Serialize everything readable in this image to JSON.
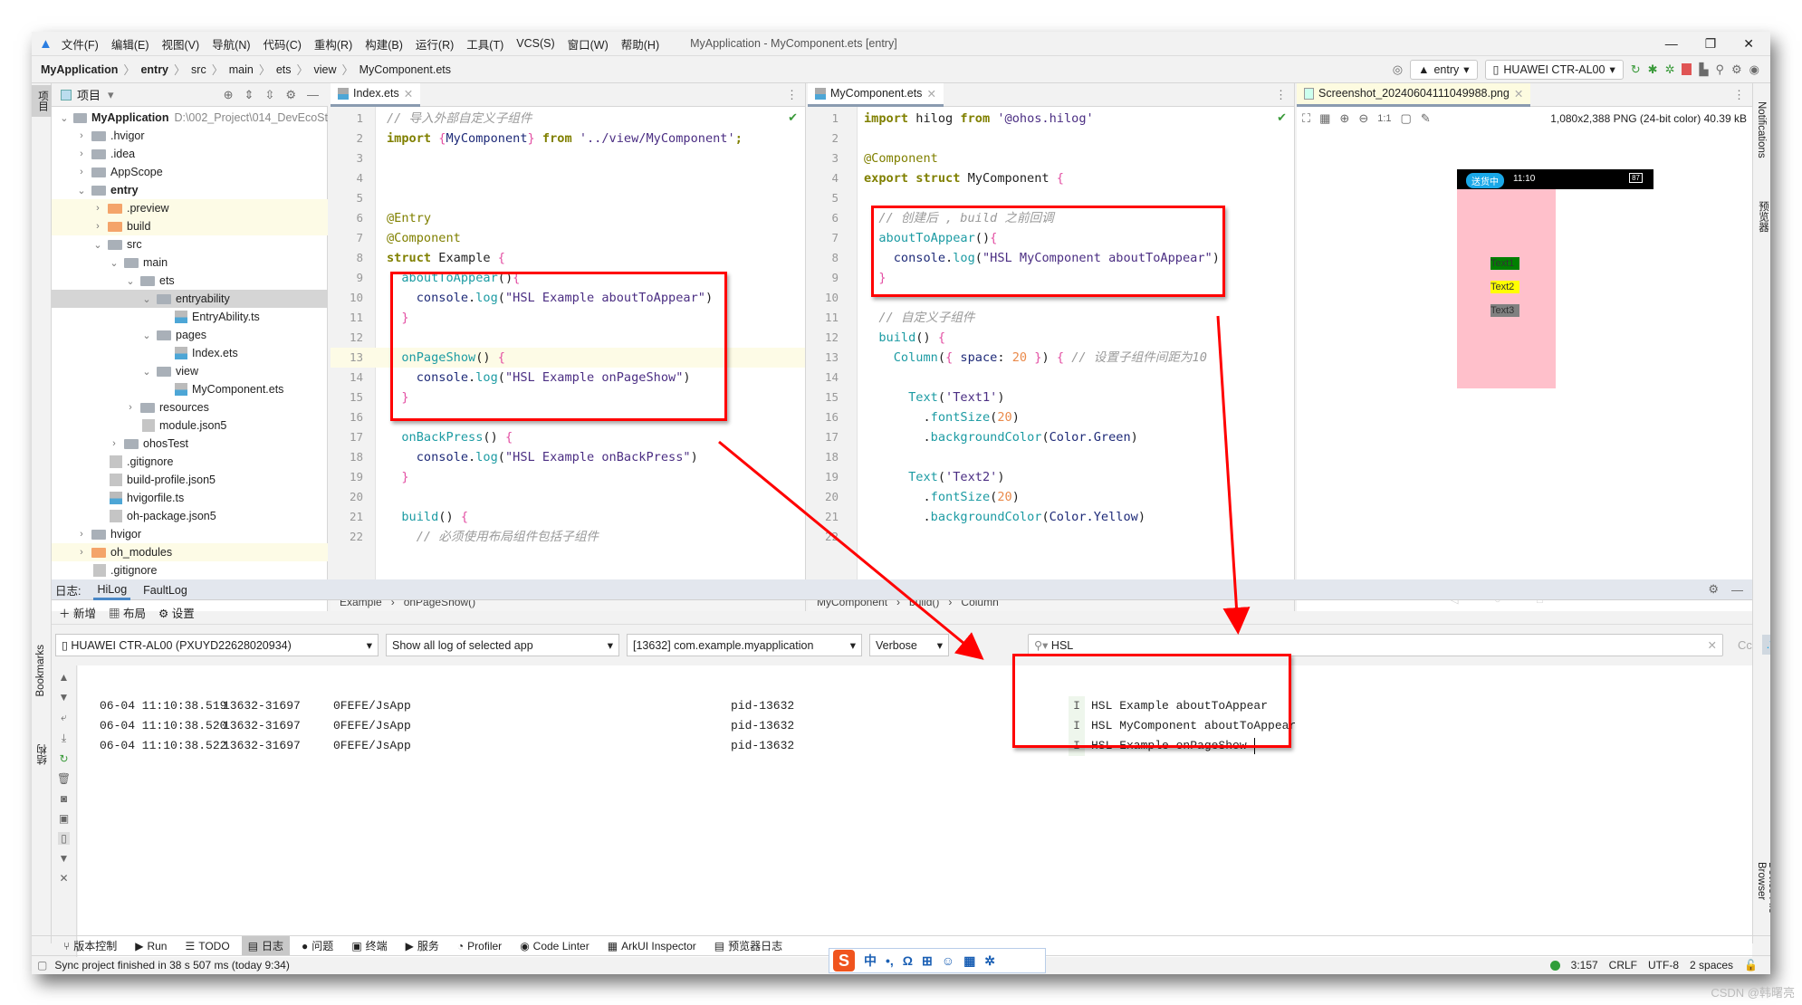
{
  "titlebar": {
    "menus": [
      "文件(F)",
      "编辑(E)",
      "视图(V)",
      "导航(N)",
      "代码(C)",
      "重构(R)",
      "构建(B)",
      "运行(R)",
      "工具(T)",
      "VCS(S)",
      "窗口(W)",
      "帮助(H)"
    ],
    "title": "MyApplication - MyComponent.ets [entry]"
  },
  "navbar": {
    "breadcrumb": [
      "MyApplication",
      "entry",
      "src",
      "main",
      "ets",
      "view",
      "MyComponent.ets"
    ],
    "run_config": "entry",
    "device": "HUAWEI CTR-AL00"
  },
  "project": {
    "header": "项目",
    "side_label": "项目",
    "tree": [
      {
        "d": 0,
        "t": "MyApplication",
        "k": "mod",
        "open": true,
        "extra": "D:\\002_Project\\014_DevEcoSt"
      },
      {
        "d": 1,
        "t": ".hvigor",
        "k": "dir"
      },
      {
        "d": 1,
        "t": ".idea",
        "k": "dir"
      },
      {
        "d": 1,
        "t": "AppScope",
        "k": "dir"
      },
      {
        "d": 1,
        "t": "entry",
        "k": "mod",
        "open": true
      },
      {
        "d": 2,
        "t": ".preview",
        "k": "odir",
        "hl": true
      },
      {
        "d": 2,
        "t": "build",
        "k": "odir",
        "hl": true
      },
      {
        "d": 2,
        "t": "src",
        "k": "dir",
        "open": true
      },
      {
        "d": 3,
        "t": "main",
        "k": "dir",
        "open": true
      },
      {
        "d": 4,
        "t": "ets",
        "k": "dir",
        "open": true
      },
      {
        "d": 5,
        "t": "entryability",
        "k": "dir",
        "open": true,
        "sel": true
      },
      {
        "d": 6,
        "t": "EntryAbility.ts",
        "k": "file"
      },
      {
        "d": 5,
        "t": "pages",
        "k": "dir",
        "open": true
      },
      {
        "d": 6,
        "t": "Index.ets",
        "k": "file"
      },
      {
        "d": 5,
        "t": "view",
        "k": "dir",
        "open": true
      },
      {
        "d": 6,
        "t": "MyComponent.ets",
        "k": "file"
      },
      {
        "d": 4,
        "t": "resources",
        "k": "dir"
      },
      {
        "d": 4,
        "t": "module.json5",
        "k": "json"
      },
      {
        "d": 3,
        "t": "ohosTest",
        "k": "dir"
      },
      {
        "d": 2,
        "t": ".gitignore",
        "k": "json"
      },
      {
        "d": 2,
        "t": "build-profile.json5",
        "k": "json"
      },
      {
        "d": 2,
        "t": "hvigorfile.ts",
        "k": "file"
      },
      {
        "d": 2,
        "t": "oh-package.json5",
        "k": "json"
      },
      {
        "d": 1,
        "t": "hvigor",
        "k": "dir"
      },
      {
        "d": 1,
        "t": "oh_modules",
        "k": "odir",
        "hl": true
      },
      {
        "d": 1,
        "t": ".gitignore",
        "k": "json"
      }
    ]
  },
  "editor_index": {
    "tab": "Index.ets",
    "breadcrumb": [
      "Example",
      "onPageShow()"
    ],
    "lines": [
      [
        [
          "cm",
          "// 导入外部自定义子组件"
        ]
      ],
      [
        [
          "kw",
          "import "
        ],
        [
          "br",
          "{"
        ],
        [
          "ob",
          "MyComponent"
        ],
        [
          "br",
          "}"
        ],
        [
          "kw",
          " from "
        ],
        [
          "st",
          "'../view/MyComponent'"
        ],
        [
          "kw",
          ";"
        ]
      ],
      [],
      [],
      [],
      [
        [
          "an",
          "@Entry"
        ]
      ],
      [
        [
          "an",
          "@Component"
        ]
      ],
      [
        [
          "kw",
          "struct "
        ],
        [
          "pl",
          "Example "
        ],
        [
          "br",
          "{"
        ]
      ],
      [
        [
          "pl",
          "  "
        ],
        [
          "fn",
          "aboutToAppear"
        ],
        [
          "pl",
          "()"
        ],
        [
          "br",
          "{"
        ]
      ],
      [
        [
          "pl",
          "    "
        ],
        [
          "ob",
          "console"
        ],
        [
          "pl",
          "."
        ],
        [
          "fn",
          "log"
        ],
        [
          "pl",
          "("
        ],
        [
          "st",
          "\"HSL Example aboutToAppear\""
        ],
        [
          "pl",
          ")"
        ]
      ],
      [
        [
          "pl",
          "  "
        ],
        [
          "br",
          "}"
        ]
      ],
      [],
      [
        [
          "pl",
          "  "
        ],
        [
          "fn",
          "onPageShow"
        ],
        [
          "pl",
          "() "
        ],
        [
          "br",
          "{"
        ]
      ],
      [
        [
          "pl",
          "    "
        ],
        [
          "ob",
          "console"
        ],
        [
          "pl",
          "."
        ],
        [
          "fn",
          "log"
        ],
        [
          "pl",
          "("
        ],
        [
          "st",
          "\"HSL Example onPageShow\""
        ],
        [
          "pl",
          ")"
        ]
      ],
      [
        [
          "pl",
          "  "
        ],
        [
          "br",
          "}"
        ]
      ],
      [],
      [
        [
          "pl",
          "  "
        ],
        [
          "fn",
          "onBackPress"
        ],
        [
          "pl",
          "() "
        ],
        [
          "br",
          "{"
        ]
      ],
      [
        [
          "pl",
          "    "
        ],
        [
          "ob",
          "console"
        ],
        [
          "pl",
          "."
        ],
        [
          "fn",
          "log"
        ],
        [
          "pl",
          "("
        ],
        [
          "st",
          "\"HSL Example onBackPress\""
        ],
        [
          "pl",
          ")"
        ]
      ],
      [
        [
          "pl",
          "  "
        ],
        [
          "br",
          "}"
        ]
      ],
      [],
      [
        [
          "pl",
          "  "
        ],
        [
          "fn",
          "build"
        ],
        [
          "pl",
          "() "
        ],
        [
          "br",
          "{"
        ]
      ],
      [
        [
          "pl",
          "    "
        ],
        [
          "cm",
          "// 必须使用布局组件包括子组件"
        ]
      ]
    ]
  },
  "editor_component": {
    "tab": "MyComponent.ets",
    "breadcrumb": [
      "MyComponent",
      "build()",
      "Column"
    ],
    "lines": [
      [
        [
          "kw",
          "import "
        ],
        [
          "pl",
          "hilog "
        ],
        [
          "kw",
          "from "
        ],
        [
          "st",
          "'@ohos.hilog'"
        ]
      ],
      [],
      [
        [
          "an",
          "@Component"
        ]
      ],
      [
        [
          "kw",
          "export struct "
        ],
        [
          "pl",
          "MyComponent "
        ],
        [
          "br",
          "{"
        ]
      ],
      [],
      [
        [
          "pl",
          "  "
        ],
        [
          "cm",
          "// 创建后 , build 之前回调"
        ]
      ],
      [
        [
          "pl",
          "  "
        ],
        [
          "fn",
          "aboutToAppear"
        ],
        [
          "pl",
          "()"
        ],
        [
          "br",
          "{"
        ]
      ],
      [
        [
          "pl",
          "    "
        ],
        [
          "ob",
          "console"
        ],
        [
          "pl",
          "."
        ],
        [
          "fn",
          "log"
        ],
        [
          "pl",
          "("
        ],
        [
          "st",
          "\"HSL MyComponent aboutToAppear\""
        ],
        [
          "pl",
          ")"
        ]
      ],
      [
        [
          "pl",
          "  "
        ],
        [
          "br",
          "}"
        ]
      ],
      [],
      [
        [
          "pl",
          "  "
        ],
        [
          "cm",
          "// 自定义子组件"
        ]
      ],
      [
        [
          "pl",
          "  "
        ],
        [
          "fn",
          "build"
        ],
        [
          "pl",
          "() "
        ],
        [
          "br",
          "{"
        ]
      ],
      [
        [
          "pl",
          "    "
        ],
        [
          "fn",
          "Column"
        ],
        [
          "pl",
          "("
        ],
        [
          "br",
          "{ "
        ],
        [
          "ob",
          "space"
        ],
        [
          "pl",
          ": "
        ],
        [
          "nm",
          "20"
        ],
        [
          "br",
          " }"
        ],
        [
          "pl",
          ") "
        ],
        [
          "br",
          "{ "
        ],
        [
          "cm",
          "// 设置子组件间距为10"
        ]
      ],
      [],
      [
        [
          "pl",
          "      "
        ],
        [
          "fn",
          "Text"
        ],
        [
          "pl",
          "("
        ],
        [
          "st",
          "'Text1'"
        ],
        [
          "pl",
          ")"
        ]
      ],
      [
        [
          "pl",
          "        ."
        ],
        [
          "fn",
          "fontSize"
        ],
        [
          "pl",
          "("
        ],
        [
          "nm",
          "20"
        ],
        [
          "pl",
          ")"
        ]
      ],
      [
        [
          "pl",
          "        ."
        ],
        [
          "fn",
          "backgroundColor"
        ],
        [
          "pl",
          "("
        ],
        [
          "ob",
          "Color.Green"
        ],
        [
          "pl",
          ")"
        ]
      ],
      [],
      [
        [
          "pl",
          "      "
        ],
        [
          "fn",
          "Text"
        ],
        [
          "pl",
          "("
        ],
        [
          "st",
          "'Text2'"
        ],
        [
          "pl",
          ")"
        ]
      ],
      [
        [
          "pl",
          "        ."
        ],
        [
          "fn",
          "fontSize"
        ],
        [
          "pl",
          "("
        ],
        [
          "nm",
          "20"
        ],
        [
          "pl",
          ")"
        ]
      ],
      [
        [
          "pl",
          "        ."
        ],
        [
          "fn",
          "backgroundColor"
        ],
        [
          "pl",
          "("
        ],
        [
          "ob",
          "Color.Yellow"
        ],
        [
          "pl",
          ")"
        ]
      ],
      []
    ]
  },
  "image_viewer": {
    "tab": "Screenshot_20240604111049988.png",
    "info": "1,080x2,388 PNG (24-bit color) 40.39 kB",
    "ratio_label": "1:1",
    "phone": {
      "status_pill": "送货中",
      "time": "11:10",
      "battery": "87",
      "texts": [
        {
          "label": "Text1",
          "bg": "#008000"
        },
        {
          "label": "Text2",
          "bg": "#ffff00"
        },
        {
          "label": "Text3",
          "bg": "#808080"
        }
      ],
      "bg": "#ffc0cb"
    }
  },
  "log": {
    "label": "日志:",
    "tabs": [
      "HiLog",
      "FaultLog"
    ],
    "active_tab": "HiLog",
    "toolbar": [
      "新增",
      "布局",
      "设置"
    ],
    "device_select": "HUAWEI CTR-AL00 (PXUYD22628020934)",
    "scope_select": "Show all log of selected app",
    "process_select": "[13632] com.example.myapplication",
    "level_select": "Verbose",
    "search_value": "HSL",
    "case_label": "Cc",
    "regex_label": ".*",
    "rows": [
      {
        "time": "06-04 11:10:38.519",
        "ids": "13632-31697",
        "tag": "0FEFE/JsApp",
        "pid": "pid-13632",
        "level": "I",
        "msg": "HSL Example aboutToAppear"
      },
      {
        "time": "06-04 11:10:38.520",
        "ids": "13632-31697",
        "tag": "0FEFE/JsApp",
        "pid": "pid-13632",
        "level": "I",
        "msg": "HSL MyComponent aboutToAppear"
      },
      {
        "time": "06-04 11:10:38.522",
        "ids": "13632-31697",
        "tag": "0FEFE/JsApp",
        "pid": "pid-13632",
        "level": "I",
        "msg": "HSL Example onPageShow"
      }
    ]
  },
  "side_left": {
    "bookmarks": "Bookmarks",
    "structure": "结构"
  },
  "side_right": {
    "notifications": "Notifications",
    "preview": "预览器",
    "device_file_browser": "Device File Browser"
  },
  "bottom_tools": [
    "版本控制",
    "Run",
    "TODO",
    "日志",
    "问题",
    "终端",
    "服务",
    "Profiler",
    "Code Linter",
    "ArkUI Inspector",
    "预览器日志"
  ],
  "bottom_active": "日志",
  "status": {
    "message": "Sync project finished in 38 s 507 ms (today 9:34)",
    "position": "3:157",
    "line_sep": "CRLF",
    "encoding": "UTF-8",
    "indent": "2 spaces"
  },
  "ime": {
    "items": [
      "中",
      "•,",
      "Ω",
      "⊞",
      "☺",
      "▦",
      "✲"
    ]
  },
  "watermark": "CSDN @韩曙亮",
  "colors": {
    "annotation_red": "#ff0000",
    "selection": "#d5d5d5",
    "highlight": "#fdfbe6"
  }
}
